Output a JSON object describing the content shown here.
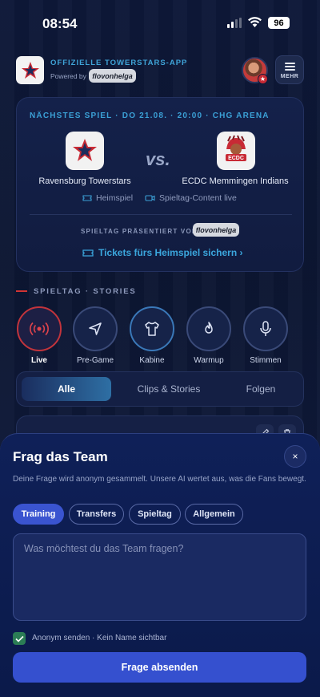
{
  "status_bar": {
    "time": "08:54",
    "battery": "96"
  },
  "header": {
    "app_title": "OFFIZIELLE TOWERSTARS-APP",
    "powered_by": "Powered by",
    "partner": "flovonhelga",
    "more_label": "MEHR"
  },
  "match": {
    "info": "NÄCHSTES SPIEL · DO 21.08. · 20:00 · CHG ARENA",
    "vs": "vs.",
    "home_team": "Ravensburg Towerstars",
    "away_team": "ECDC Memmingen Indians",
    "tag_home": "Heimspiel",
    "tag_content": "Spieltag-Content live",
    "presented_by": "SPIELTAG PRÄSENTIERT VON",
    "partner": "flovonhelga",
    "tickets": "Tickets fürs Heimspiel sichern ›"
  },
  "stories": {
    "section_title": "SPIELTAG · STORIES",
    "items": [
      {
        "label": "Live",
        "icon": "broadcast-icon"
      },
      {
        "label": "Pre-Game",
        "icon": "navigation-arrow-icon"
      },
      {
        "label": "Kabine",
        "icon": "jersey-icon"
      },
      {
        "label": "Warmup",
        "icon": "flame-icon"
      },
      {
        "label": "Stimmen",
        "icon": "microphone-icon"
      }
    ]
  },
  "tabs": [
    "Alle",
    "Clips & Stories",
    "Folgen"
  ],
  "sheet": {
    "title": "Frag das Team",
    "close": "×",
    "description": "Deine Frage wird anonym gesammelt. Unsere AI wertet aus, was die Fans bewegt.",
    "categories": [
      "Training",
      "Transfers",
      "Spieltag",
      "Allgemein"
    ],
    "selected_category": "Training",
    "input_placeholder": "Was möchtest du das Team fragen?",
    "input_value": "",
    "anonymous_checked": true,
    "anonymous_label": "Anonym senden · Kein Name sichtbar",
    "submit_label": "Frage absenden"
  },
  "colors": {
    "accent_blue": "#3ba0d6",
    "primary_button": "#3550cf",
    "live_red": "#c2343c",
    "checkbox_green": "#2b7d55"
  }
}
